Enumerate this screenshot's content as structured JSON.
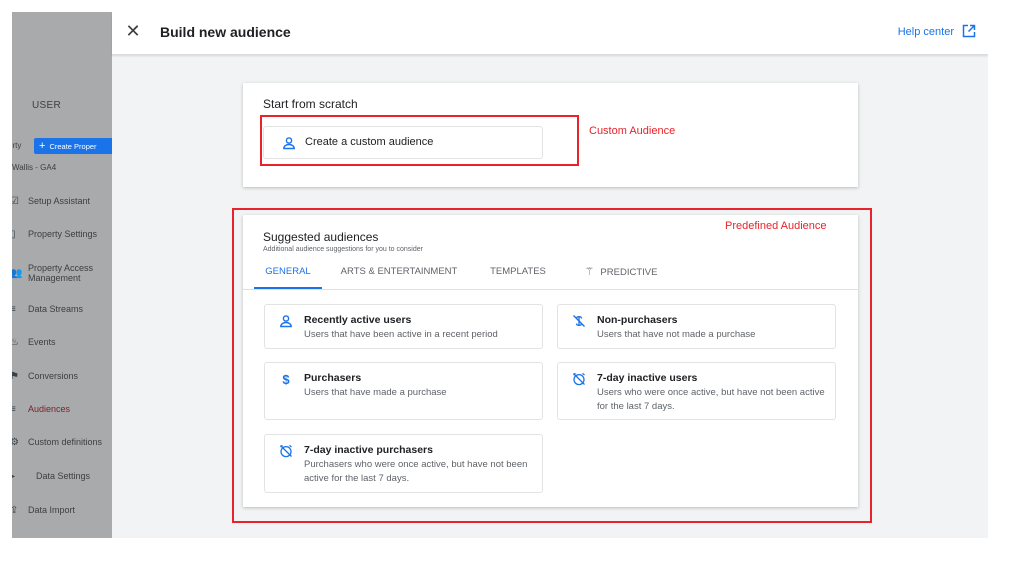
{
  "sidebar": {
    "section_title": "USER",
    "property_label": "erty",
    "create_button": "Create Proper",
    "property_name": "Wallis - GA4",
    "items": [
      {
        "label": "Setup Assistant",
        "icon": "checklist-icon",
        "glyph": "☑"
      },
      {
        "label": "Property Settings",
        "icon": "settings-page-icon",
        "glyph": "▯"
      },
      {
        "label": "Property Access Management",
        "icon": "people-icon",
        "glyph": "👥"
      },
      {
        "label": "Data Streams",
        "icon": "streams-icon",
        "glyph": "≡"
      },
      {
        "label": "Events",
        "icon": "events-icon",
        "glyph": "♨"
      },
      {
        "label": "Conversions",
        "icon": "flag-icon",
        "glyph": "⚑"
      },
      {
        "label": "Audiences",
        "icon": "audiences-icon",
        "glyph": "≡"
      },
      {
        "label": "Custom definitions",
        "icon": "custom-definitions-icon",
        "glyph": "⚙"
      },
      {
        "label": "Data Settings",
        "icon": "data-settings-icon",
        "glyph": "▸"
      },
      {
        "label": "Data Import",
        "icon": "import-icon",
        "glyph": "⇪"
      }
    ]
  },
  "header": {
    "close_glyph": "✕",
    "title": "Build new audience",
    "help_label": "Help center"
  },
  "scratch": {
    "title": "Start from scratch",
    "option_label": "Create a custom audience"
  },
  "suggested": {
    "title": "Suggested audiences",
    "subtitle": "Additional audience suggestions for you to consider",
    "tabs": [
      {
        "label": "GENERAL",
        "active": true
      },
      {
        "label": "ARTS & ENTERTAINMENT",
        "active": false
      },
      {
        "label": "TEMPLATES",
        "active": false
      },
      {
        "label": "PREDICTIVE",
        "active": false,
        "icon": "magic-wand-icon"
      }
    ],
    "audiences": [
      {
        "name": "Recently active users",
        "description": "Users that have been active in a recent period",
        "icon": "person-icon"
      },
      {
        "name": "Non-purchasers",
        "description": "Users that have not made a purchase",
        "icon": "no-purchase-icon"
      },
      {
        "name": "Purchasers",
        "description": "Users that have made a purchase",
        "icon": "dollar-icon"
      },
      {
        "name": "7-day inactive users",
        "description": "Users who were once active, but have not been active for the last 7 days.",
        "icon": "alarm-off-icon"
      },
      {
        "name": "7-day inactive purchasers",
        "description": "Purchasers who were once active, but have not been active for the last 7 days.",
        "icon": "alarm-off-icon"
      }
    ]
  },
  "annotations": {
    "custom": "Custom Audience",
    "predefined": "Predefined Audience",
    "color": "#e8232b"
  },
  "colors": {
    "accent": "#1a73e8",
    "sidebar_overlay": "#a9aaab",
    "canvas": "#f1f3f4"
  }
}
